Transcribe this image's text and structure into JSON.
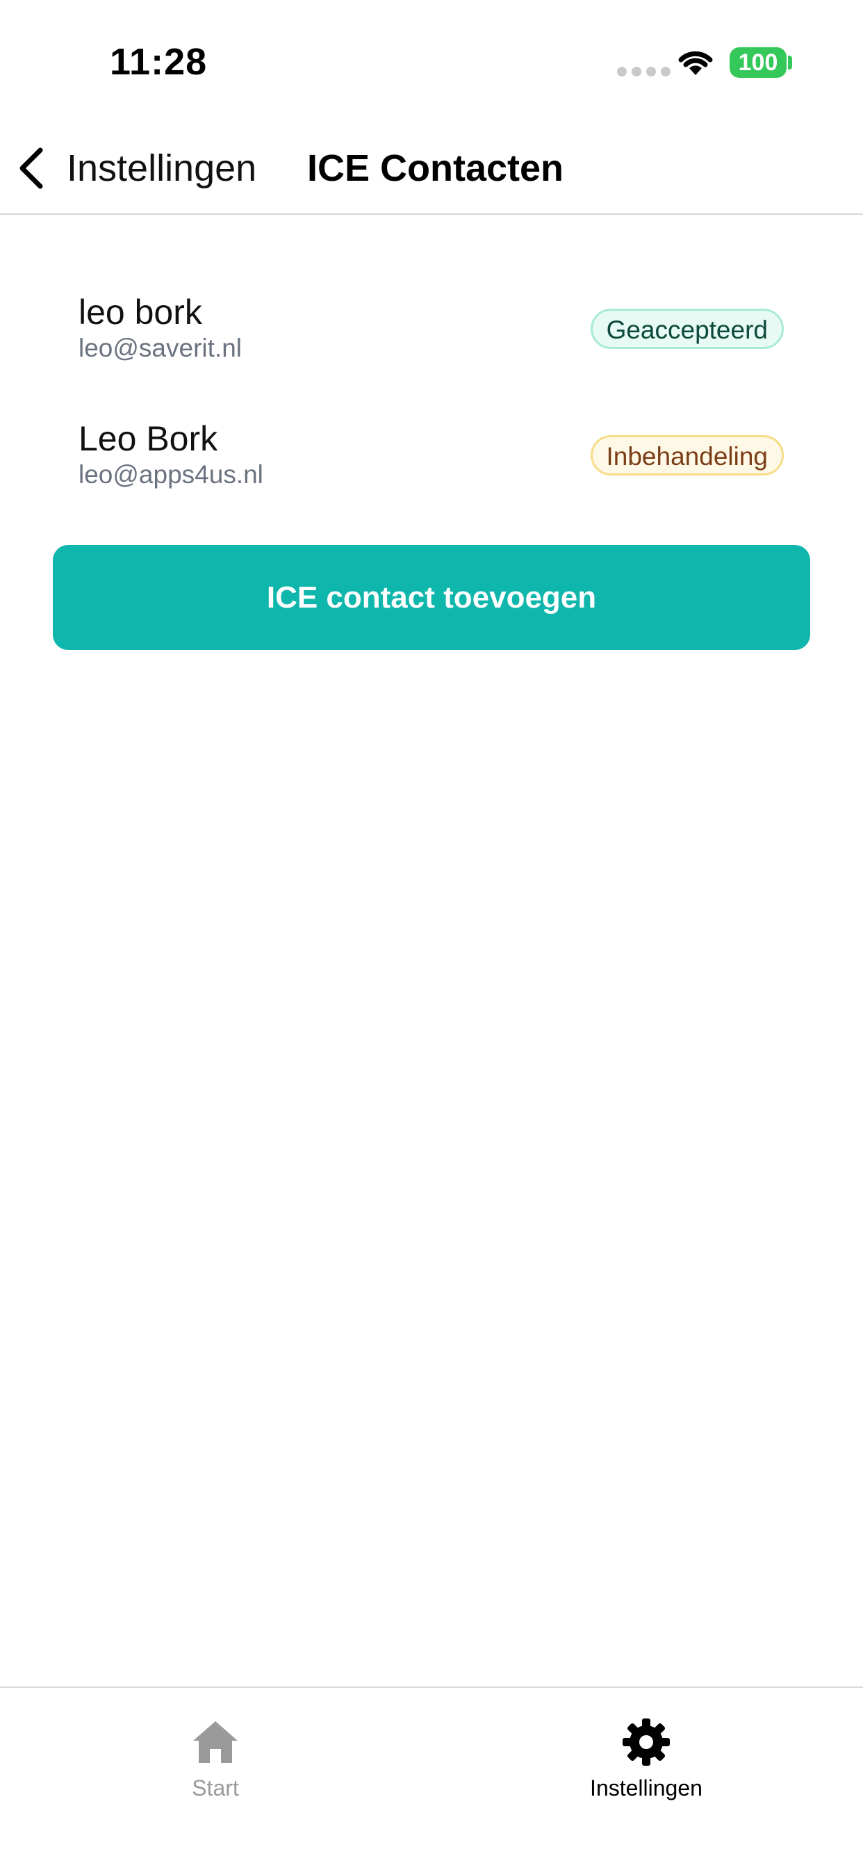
{
  "status_bar": {
    "time": "11:28",
    "battery": "100",
    "icons": [
      "signal-dots-icon",
      "wifi-icon",
      "battery-icon"
    ]
  },
  "nav": {
    "back_label": "Instellingen",
    "title": "ICE Contacten",
    "back_icon": "chevron-left-icon"
  },
  "contacts": [
    {
      "name": "leo bork",
      "email": "leo@saverit.nl",
      "status": "Geaccepteerd",
      "status_color": "#e7faf3"
    },
    {
      "name": "Leo Bork",
      "email": "leo@apps4us.nl",
      "status": "Inbehandeling",
      "status_color": "#fef9e6"
    }
  ],
  "add_button": {
    "label": "ICE contact toevoegen",
    "color": "#0fb6ab"
  },
  "tab_bar": {
    "tabs": [
      {
        "label": "Start",
        "icon": "home-icon",
        "active": false
      },
      {
        "label": "Instellingen",
        "icon": "gear-icon",
        "active": true
      }
    ]
  }
}
